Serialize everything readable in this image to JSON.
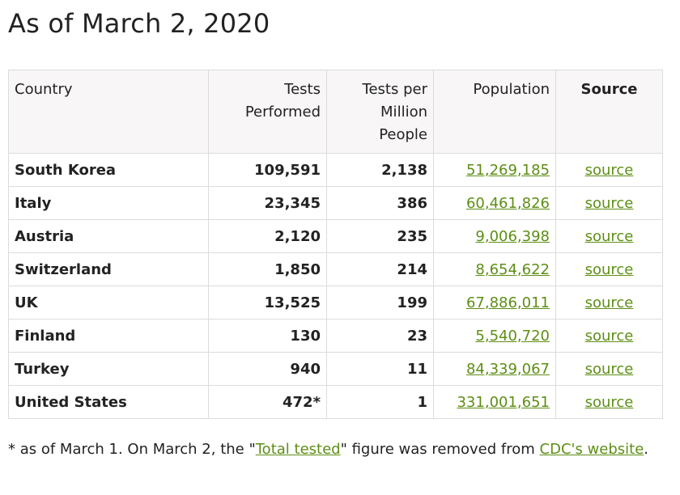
{
  "heading": "As of March 2, 2020",
  "table": {
    "headers": {
      "country": "Country",
      "tests_line1": "Tests",
      "tests_line2": "Performed",
      "tpm_line1": "Tests per",
      "tpm_line2": "Million",
      "tpm_line3": "People",
      "population": "Population",
      "source": "Source"
    },
    "rows": [
      {
        "country": "South Korea",
        "tests": "109,591",
        "per_million": "2,138",
        "population": "51,269,185",
        "source": "source"
      },
      {
        "country": "Italy",
        "tests": "23,345",
        "per_million": "386",
        "population": "60,461,826",
        "source": "source"
      },
      {
        "country": "Austria",
        "tests": "2,120",
        "per_million": "235",
        "population": "9,006,398",
        "source": "source"
      },
      {
        "country": "Switzerland",
        "tests": "1,850",
        "per_million": "214",
        "population": "8,654,622",
        "source": "source"
      },
      {
        "country": "UK",
        "tests": "13,525",
        "per_million": "199",
        "population": "67,886,011",
        "source": "source"
      },
      {
        "country": "Finland",
        "tests": "130",
        "per_million": "23",
        "population": "5,540,720",
        "source": "source"
      },
      {
        "country": "Turkey",
        "tests": "940",
        "per_million": "11",
        "population": "84,339,067",
        "source": "source"
      },
      {
        "country": "United States",
        "tests": "472*",
        "per_million": "1",
        "population": "331,001,651",
        "source": "source"
      }
    ]
  },
  "footnote": {
    "part1": "* as of March 1. On March 2, the \"",
    "link1": "Total tested",
    "part2": "\" figure was removed from ",
    "link2": "CDC's website",
    "part3": "."
  },
  "colors": {
    "link": "#5e8e16",
    "header_bg": "#f8f6f6",
    "border": "#dcdcdc",
    "text": "#222222"
  }
}
